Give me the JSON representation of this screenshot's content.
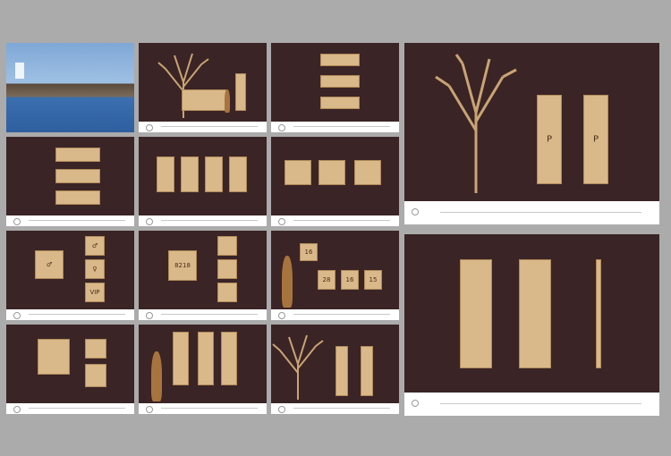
{
  "title_strip": "",
  "colors": {
    "background": "#ababab",
    "panel": "#3a2426",
    "sign": "#d9b88a"
  },
  "room_numbers": [
    "8218",
    "16",
    "28",
    "16",
    "15"
  ],
  "pictograms": [
    "restroom-male",
    "restroom-female",
    "restroom-accessible",
    "vip",
    "parking",
    "arrow"
  ],
  "labels": {
    "vip": "VIP",
    "parking": "P"
  }
}
